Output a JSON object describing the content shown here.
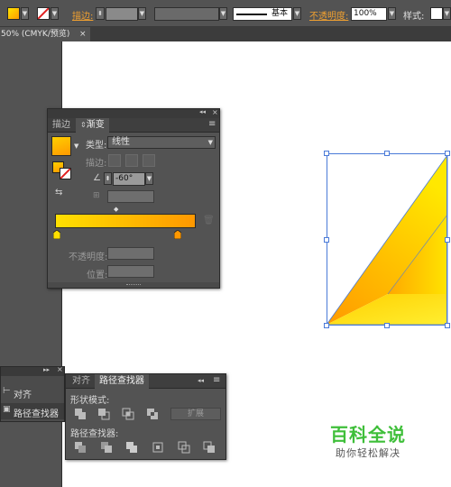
{
  "toolbar": {
    "stroke_label": "描边:",
    "stroke_profile": "基本",
    "opacity_label": "不透明度:",
    "opacity_value": "100%",
    "style_label": "样式:"
  },
  "document_tab": {
    "title": "50% (CMYK/预览)",
    "close": "×"
  },
  "gradient_panel": {
    "tabs": [
      "描边",
      "渐变"
    ],
    "type_label": "类型:",
    "type_value": "线性",
    "stroke_label": "描边:",
    "angle_value": "-60°",
    "opacity_label": "不透明度:",
    "location_label": "位置:",
    "gradient_start_color": "#ffe000",
    "gradient_end_color": "#ff9800",
    "menu": "≡"
  },
  "align_panel": {
    "items": [
      "对齐",
      "路径查找器"
    ]
  },
  "pathfinder_panel": {
    "tabs": [
      "对齐",
      "路径查找器"
    ],
    "shape_modes_label": "形状模式:",
    "expand_label": "扩展",
    "pathfinders_label": "路径查找器:"
  },
  "watermark": {
    "title": "百科全说",
    "subtitle": "助你轻松解决"
  },
  "colors": {
    "panel_bg": "#535353",
    "accent_orange": "#f0a030",
    "selection_blue": "#4a7ad8",
    "watermark_green": "#3fbf3a"
  }
}
